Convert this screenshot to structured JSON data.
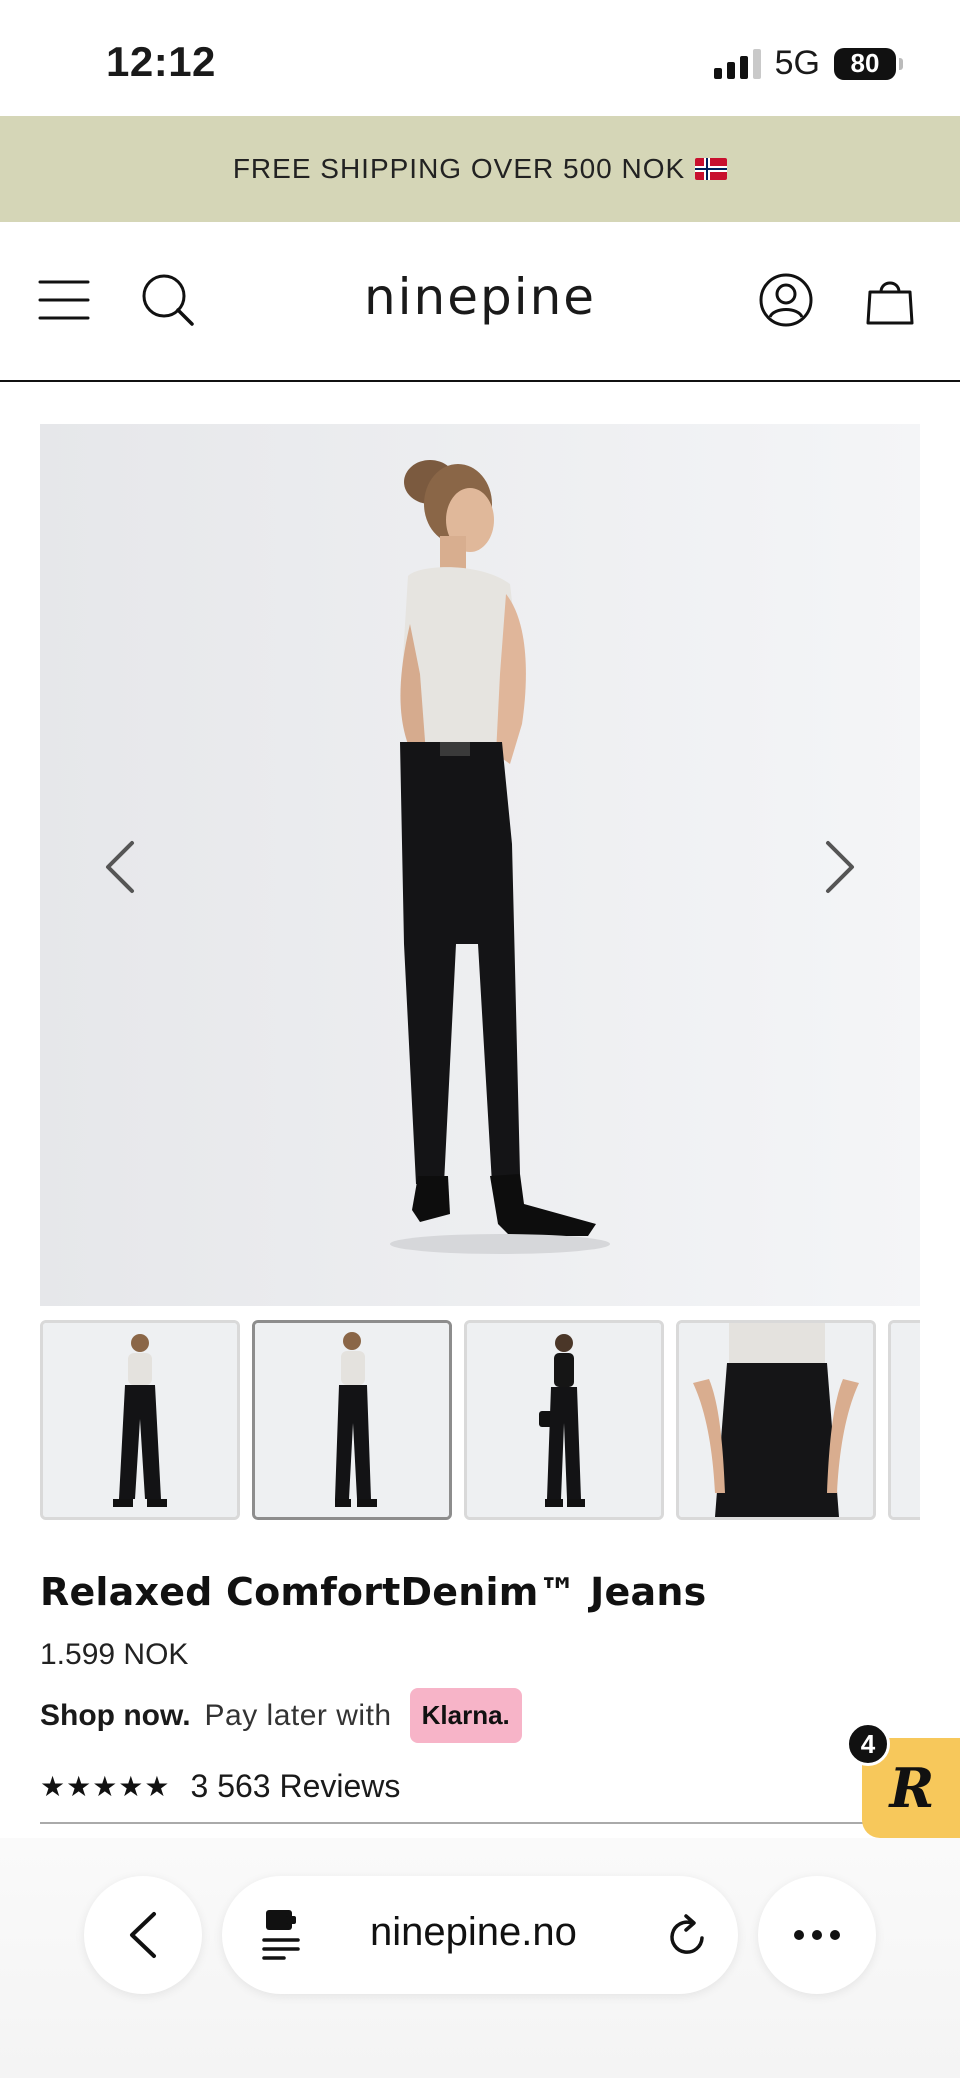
{
  "status_bar": {
    "time": "12:12",
    "network": "5G",
    "battery": "80"
  },
  "promo": {
    "text": "FREE SHIPPING OVER 500 NOK"
  },
  "header": {
    "logo": "ninepine"
  },
  "gallery": {
    "thumbnail_count": 5,
    "active_index": 2
  },
  "product": {
    "title": "Relaxed ComfortDenim™ Jeans",
    "price": "1.599 NOK",
    "shop_now": "Shop now.",
    "pay_later": "Pay later with",
    "klarna": "Klarna.",
    "stars": "★★★★★",
    "reviews": "3 563 Reviews"
  },
  "rewards": {
    "badge_count": "4",
    "logo": "R"
  },
  "browser": {
    "url": "ninepine.no"
  }
}
